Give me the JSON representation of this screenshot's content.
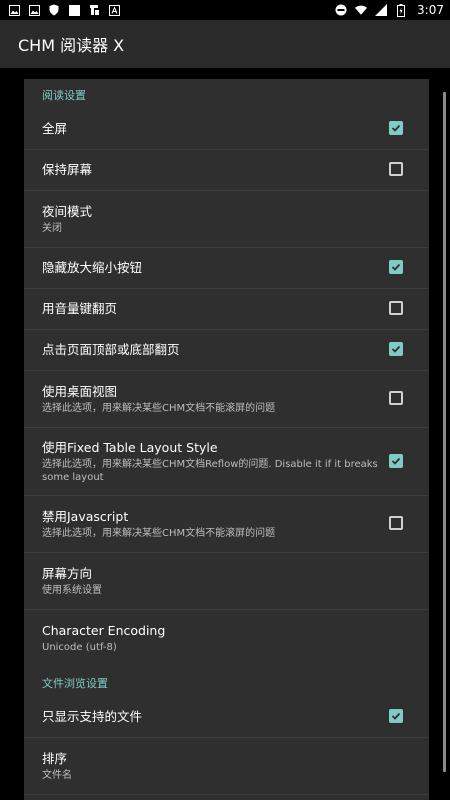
{
  "status_bar": {
    "left_icons": [
      "image-icon",
      "image-icon",
      "shield-icon",
      "square-icon",
      "chm-app-icon",
      "font-icon"
    ],
    "right_icons": [
      "dnd-icon",
      "wifi-icon",
      "signal-icon",
      "battery-icon"
    ],
    "time": "3:07"
  },
  "app_bar": {
    "title": "CHM 阅读器 X"
  },
  "sections": [
    {
      "header": "阅读设置",
      "items": [
        {
          "title": "全屏",
          "summary": "",
          "checkbox": true,
          "checked": true
        },
        {
          "title": "保持屏幕",
          "summary": "",
          "checkbox": true,
          "checked": false
        },
        {
          "title": "夜间模式",
          "summary": "关闭",
          "checkbox": false
        },
        {
          "title": "隐藏放大缩小按钮",
          "summary": "",
          "checkbox": true,
          "checked": true
        },
        {
          "title": "用音量键翻页",
          "summary": "",
          "checkbox": true,
          "checked": false
        },
        {
          "title": "点击页面顶部或底部翻页",
          "summary": "",
          "checkbox": true,
          "checked": true
        },
        {
          "title": "使用桌面视图",
          "summary": "选择此选项，用来解决某些CHM文档不能滚屏的问题",
          "checkbox": true,
          "checked": false
        },
        {
          "title": "使用Fixed Table Layout Style",
          "summary": "选择此选项，用来解决某些CHM文档Reflow的问题. Disable it if it breaks some layout",
          "checkbox": true,
          "checked": true
        },
        {
          "title": "禁用Javascript",
          "summary": "选择此选项，用来解决某些CHM文档不能滚屏的问题",
          "checkbox": true,
          "checked": false
        },
        {
          "title": "屏幕方向",
          "summary": "使用系统设置",
          "checkbox": false
        },
        {
          "title": "Character Encoding",
          "summary": "Unicode (utf-8)",
          "checkbox": false
        }
      ]
    },
    {
      "header": "文件浏览设置",
      "items": [
        {
          "title": "只显示支持的文件",
          "summary": "",
          "checkbox": true,
          "checked": true
        },
        {
          "title": "排序",
          "summary": "文件名",
          "checkbox": false
        }
      ]
    }
  ],
  "colors": {
    "accent": "#80cbc4",
    "panel": "#2f2f2f",
    "app_bar": "#2b2b2b",
    "background": "#000000"
  }
}
